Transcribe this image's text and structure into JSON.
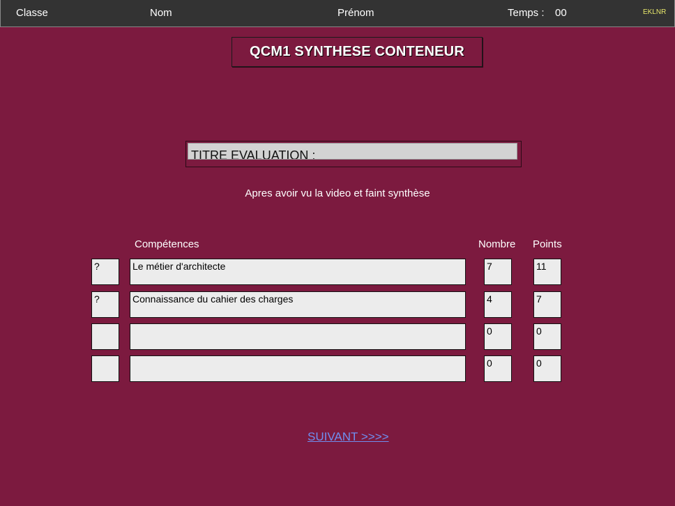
{
  "header": {
    "classe": "Classe",
    "nom": "Nom",
    "prenom": "Prénom",
    "temps_label": "Temps :",
    "temps_value": "00",
    "brand": "EKLNR"
  },
  "title": "QCM1 SYNTHESE CONTENEUR",
  "evaluation": {
    "label": "TITRE EVALUATION :"
  },
  "instruction": "Apres avoir vu la video et faint synthèse",
  "table": {
    "headers": {
      "competences": "Compétences",
      "nombre": "Nombre",
      "points": "Points"
    },
    "rows": [
      {
        "mark": "?",
        "competence": "Le métier d'architecte",
        "nombre": "7",
        "points": "11"
      },
      {
        "mark": "?",
        "competence": "Connaissance du cahier des charges",
        "nombre": "4",
        "points": "7"
      },
      {
        "mark": "",
        "competence": "",
        "nombre": "0",
        "points": "0"
      },
      {
        "mark": "",
        "competence": "",
        "nombre": "0",
        "points": "0"
      }
    ]
  },
  "next_link": "SUIVANT >>>>",
  "colors": {
    "background": "#7c1a3f",
    "topbar": "#333333",
    "cells": "#ececec",
    "link": "#6f8ff0"
  }
}
